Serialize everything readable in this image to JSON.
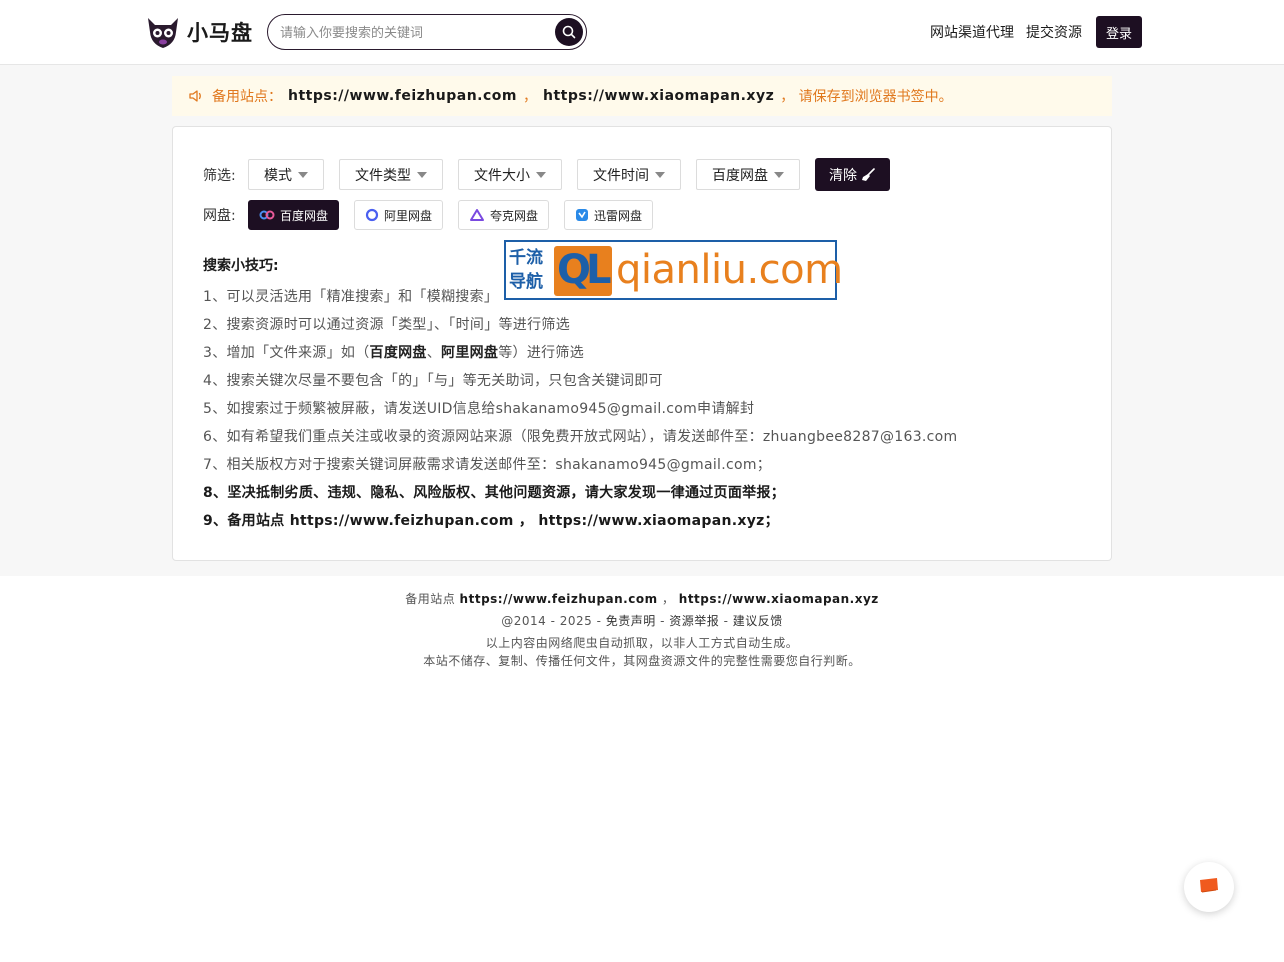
{
  "header": {
    "logo_text": "小马盘",
    "search_placeholder": "请输入你要搜索的关键词",
    "nav": [
      "网站渠道代理",
      "提交资源"
    ],
    "login_label": "登录"
  },
  "notice": {
    "prefix": "备用站点：",
    "url1": "https://www.feizhupan.com",
    "sep": "，",
    "url2": "https://www.xiaomapan.xyz",
    "suffix": "， 请保存到浏览器书签中。"
  },
  "filters": {
    "label": "筛选:",
    "options": [
      "模式",
      "文件类型",
      "文件大小",
      "文件时间",
      "百度网盘"
    ],
    "clear_label": "清除"
  },
  "disks": {
    "label": "网盘:",
    "items": [
      {
        "label": "百度网盘",
        "icon": "baidu-icon",
        "active": true
      },
      {
        "label": "阿里网盘",
        "icon": "aliyun-icon",
        "active": false
      },
      {
        "label": "夸克网盘",
        "icon": "quark-icon",
        "active": false
      },
      {
        "label": "迅雷网盘",
        "icon": "xunlei-icon",
        "active": false
      }
    ]
  },
  "tips": {
    "title": "搜索小技巧:",
    "t1": "1、可以灵活选用「精准搜索」和「模糊搜索」",
    "t2": "2、搜索资源时可以通过资源「类型」、「时间」等进行筛选",
    "t3_a": "3、增加「文件来源」如（",
    "t3_b": "百度网盘",
    "t3_c": "、",
    "t3_d": "阿里网盘",
    "t3_e": "等）进行筛选",
    "t4": "4、搜索关键次尽量不要包含「的」「与」等无关助词，只包含关键词即可",
    "t5": "5、如搜索过于频繁被屏蔽，请发送UID信息给shakanamo945@gmail.com申请解封",
    "t6": "6、如有希望我们重点关注或收录的资源网站来源（限免费开放式网站），请发送邮件至：zhuangbee8287@163.com",
    "t7": "7、相关版权方对于搜索关键词屏蔽需求请发送邮件至：shakanamo945@gmail.com；",
    "t8": "8、坚决抵制劣质、违规、隐私、风险版权、其他问题资源，请大家发现一律通过页面举报；",
    "t9": "9、备用站点 https://www.feizhupan.com ， https://www.xiaomapan.xyz；"
  },
  "ad": {
    "left_line1": "千流",
    "left_line2": "导航",
    "ql_q": "Q",
    "ql_l": "L",
    "domain": "qianliu.com"
  },
  "footer": {
    "backup_prefix": "备用站点",
    "url1": "https://www.feizhupan.com",
    "sep": "，",
    "url2": "https://www.xiaomapan.xyz",
    "copyright": "@2014 - 2025 -",
    "link1": "免责声明",
    "dash": "-",
    "link2": "资源举报",
    "link3": "建议反馈",
    "line3": "以上内容由网络爬虫自动抓取，以非人工方式自动生成。",
    "line4": "本站不储存、复制、传播任何文件，其网盘资源文件的完整性需要您自行判断。"
  },
  "colors": {
    "brand_dark": "#1d0f22",
    "notice_orange": "#e0781e",
    "notice_bg": "#fffaeb",
    "ad_blue": "#1d5fa8",
    "ad_orange": "#e8801e"
  }
}
